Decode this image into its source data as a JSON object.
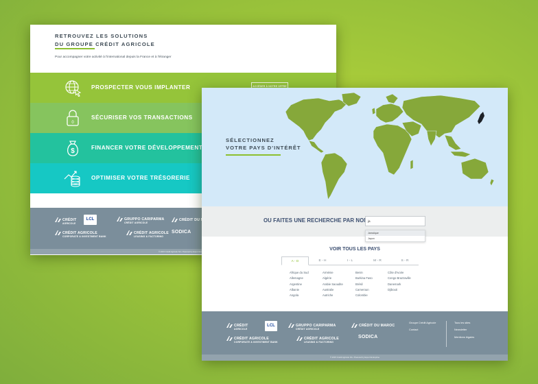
{
  "colors": {
    "accent": "#8cbf2e",
    "prospecter": "#95c43a",
    "securiser": "#86c45e",
    "financer": "#23c29e",
    "optimiser": "#16c8c4",
    "footer": "#7b8e9b"
  },
  "back": {
    "title_line1": "RETROUVEZ LES SOLUTIONS",
    "title_line2": "DU GROUPE CRÉDIT AGRICOLE",
    "subtitle": "Pour accompagner votre activité à l'international depuis la France et à l'étranger",
    "solutions": [
      {
        "label": "PROSPECTER VOUS IMPLANTER",
        "icon": "globe-cursor-icon"
      },
      {
        "label": "SÉCURISER VOS TRANSACTIONS",
        "icon": "padlock-icon"
      },
      {
        "label": "FINANCER VOTRE DÉVELOPPEMENT",
        "icon": "money-bag-icon"
      },
      {
        "label": "OPTIMISER VOTRE TRÉSORERIE",
        "icon": "coins-chart-icon"
      }
    ],
    "access_button": "ACCÉDER À NOTRE OFFRE",
    "footer_logos": {
      "ca_line1": "CRÉDIT",
      "ca_line2": "AGRICOLE",
      "lcl": "LCL",
      "cariparma1": "GRUPPO CARIPARMA",
      "cariparma2": "CRÉDIT AGRICOLE",
      "maroc": "CRÉDIT DU MAROC",
      "cacib1": "CRÉDIT AGRICOLE",
      "cacib2": "CORPORATE & INVESTMENT BANK",
      "leasing1": "CRÉDIT AGRICOLE",
      "leasing2": "LEASING & FACTORING",
      "sodica": "SODICA"
    },
    "copyright": "© 2015 Crédit Agricole SA  •  Powered by Export Entreprise"
  },
  "front": {
    "map_title_line1": "SÉLECTIONNEZ",
    "map_title_line2": "VOTRE PAYS D'INTÉRÊT",
    "search_label": "OU FAITES UNE RECHERCHE PAR NOM",
    "search_value": "ja",
    "suggestions": [
      "Jamaïque",
      "Japon"
    ],
    "voir_tous": "VOIR TOUS LES PAYS",
    "tabs": [
      "A - D",
      "E - H",
      "I - L",
      "M - R",
      "S - R"
    ],
    "columns": [
      [
        "Afrique du Sud",
        "Allemagne",
        "Argentine",
        "Albanie",
        "Angola"
      ],
      [
        "Arménie",
        "Algérie",
        "Arabie Saoudite",
        "Australie",
        "Autriche"
      ],
      [
        "Benin",
        "Burkina Faso",
        "Brésil",
        "Cameroun",
        "Colombie"
      ],
      [
        "Côte d'Ivoire",
        "Congo Brazzaville",
        "Danemark",
        "Djibouti"
      ]
    ],
    "footer_links": [
      "Groupe Crédit Agricole",
      "Contact"
    ],
    "footer_links2": [
      "Tous les sites",
      "Newsletter",
      "Mentions légales"
    ],
    "copyright": "© 2015 Crédit Agricole SA  •  Powered by Export Entreprise"
  }
}
